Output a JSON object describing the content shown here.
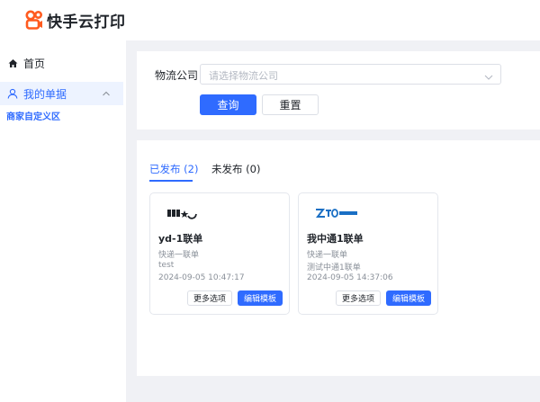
{
  "app": {
    "name": "快手云打印"
  },
  "sidebar": {
    "home_label": "首页",
    "orders_label": "我的单据",
    "sub_label": "商家自定义区"
  },
  "search": {
    "label": "物流公司",
    "placeholder": "请选择物流公司",
    "query_label": "查询",
    "reset_label": "重置"
  },
  "tabs": [
    {
      "label": "已发布 (2)",
      "active": true
    },
    {
      "label": "未发布 (0)",
      "active": false
    }
  ],
  "cards": [
    {
      "brand_icon": "yunda-logo",
      "title": "yd-1联单",
      "type": "快递一联单",
      "desc": "test",
      "time": "2024-09-05 10:47:17",
      "more_label": "更多选项",
      "edit_label": "编辑模板"
    },
    {
      "brand_icon": "zto-logo",
      "title": "我中通1联单",
      "type": "快递一联单",
      "desc": "测试中通1联单",
      "time": "2024-09-05 14:37:06",
      "more_label": "更多选项",
      "edit_label": "编辑模板"
    }
  ],
  "colors": {
    "accent": "#2f6bff",
    "logo": "#ff5b1f",
    "background": "#f0f1f5"
  }
}
